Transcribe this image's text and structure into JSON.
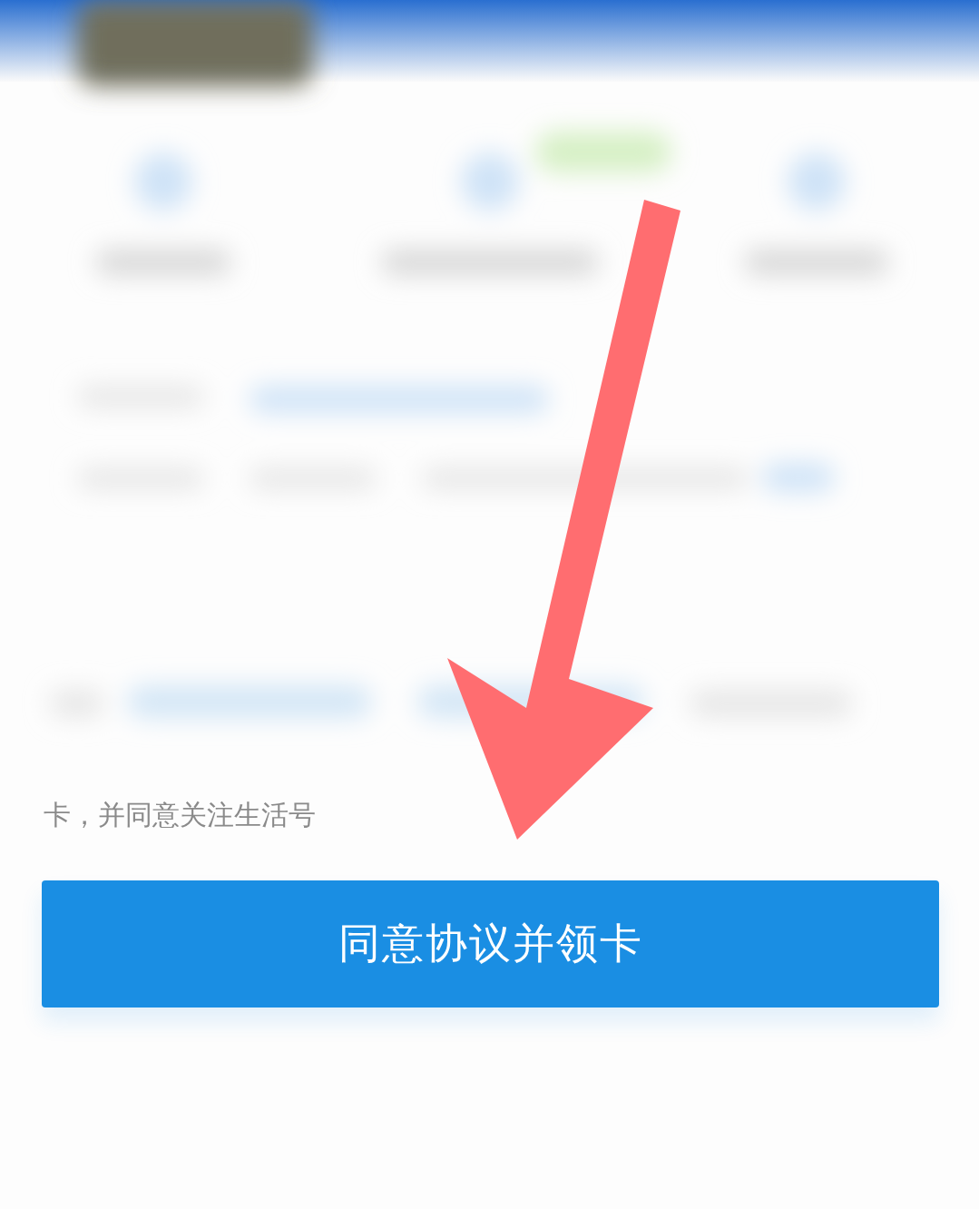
{
  "notice": {
    "text": "卡，并同意关注生活号"
  },
  "button": {
    "label": "同意协议并领卡"
  }
}
